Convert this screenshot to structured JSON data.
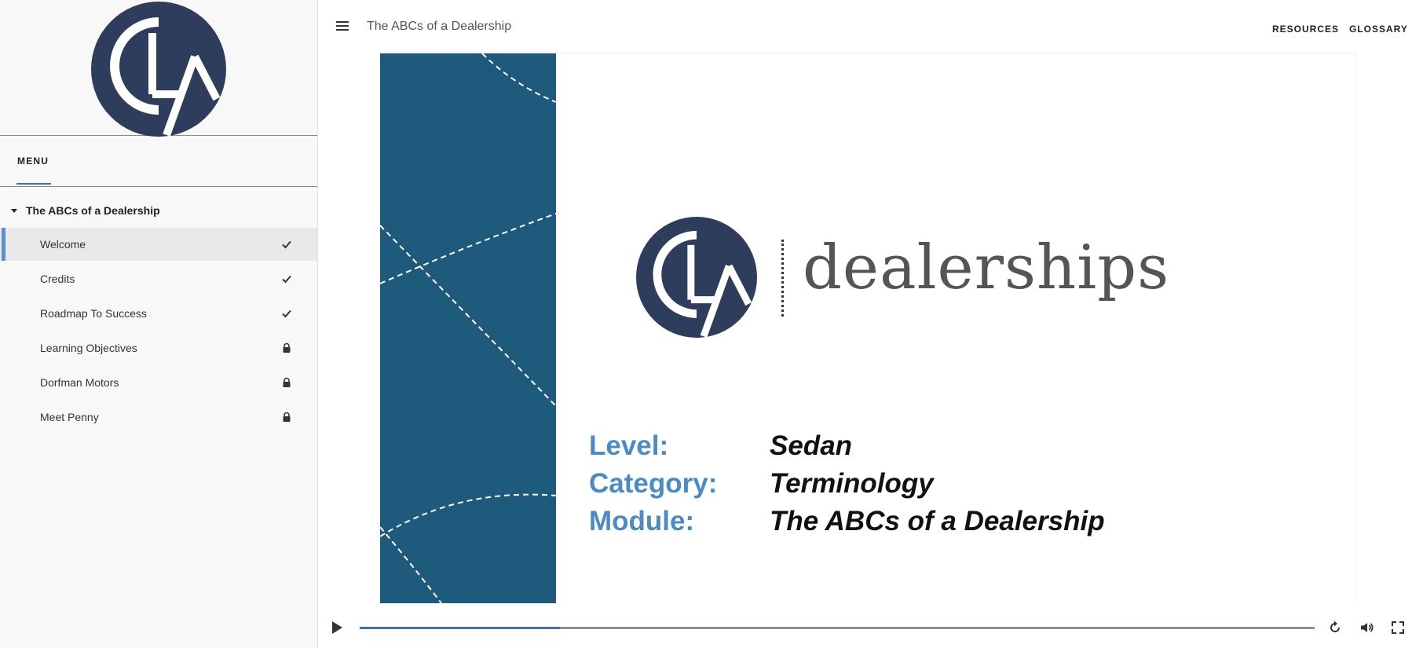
{
  "header": {
    "course_title": "The ABCs of a Dealership",
    "resources_label": "RESOURCES",
    "glossary_label": "GLOSSARY"
  },
  "sidebar": {
    "menu_tab_label": "MENU",
    "section_title": "The ABCs of a Dealership",
    "items": [
      {
        "label": "Welcome",
        "status": "complete",
        "active": true
      },
      {
        "label": "Credits",
        "status": "complete",
        "active": false
      },
      {
        "label": "Roadmap To Success",
        "status": "complete",
        "active": false
      },
      {
        "label": "Learning Objectives",
        "status": "locked",
        "active": false
      },
      {
        "label": "Dorfman Motors",
        "status": "locked",
        "active": false
      },
      {
        "label": "Meet Penny",
        "status": "locked",
        "active": false
      }
    ]
  },
  "slide": {
    "brand_word": "dealerships",
    "meta": [
      {
        "label": "Level:",
        "value": "Sedan"
      },
      {
        "label": "Category:",
        "value": "Terminology"
      },
      {
        "label": "Module:",
        "value": "The ABCs of a Dealership"
      }
    ]
  },
  "player": {
    "progress_fraction": 0.21,
    "controls": [
      "play-icon",
      "replay-icon",
      "volume-icon",
      "fullscreen-icon"
    ]
  },
  "colors": {
    "brand_navy": "#2e3d5c",
    "slide_band": "#1e5a7c",
    "meta_label": "#4a8bc4",
    "accent": "#3f6fb0"
  }
}
